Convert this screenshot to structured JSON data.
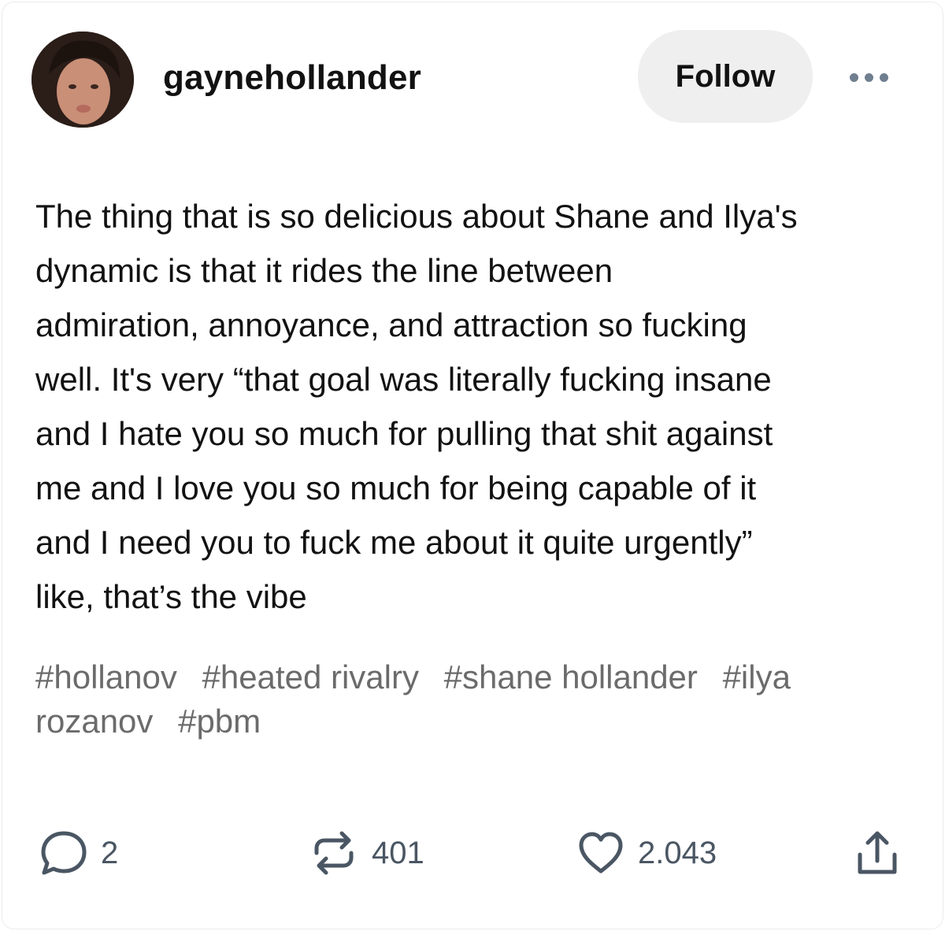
{
  "header": {
    "username": "gaynehollander",
    "follow_label": "Follow",
    "more_icon": "ellipsis-icon"
  },
  "post": {
    "lines": [
      "The thing that is so delicious about Shane and Ilya's",
      "dynamic is that it rides the line between",
      "admiration, annoyance, and attraction so fucking",
      "well. It's very “that goal was literally fucking insane",
      "and I hate you so much for pulling that shit against",
      "me and I love you so much for being capable of it",
      "and I need you to fuck me about it quite urgently”",
      "like, that’s the vibe"
    ],
    "tags": [
      "#hollanov",
      "#heated rivalry",
      "#shane hollander",
      "#ilya rozanov",
      "#pbm"
    ]
  },
  "actions": {
    "comments": {
      "icon": "comment-icon",
      "count": "2"
    },
    "reblogs": {
      "icon": "reblog-icon",
      "count": "401"
    },
    "likes": {
      "icon": "heart-icon",
      "count": "2.043"
    },
    "share": {
      "icon": "share-icon"
    }
  },
  "colors": {
    "text": "#121212",
    "tags": "#6b6b6b",
    "icons": "#4a5663",
    "follow_bg": "#efefef"
  }
}
